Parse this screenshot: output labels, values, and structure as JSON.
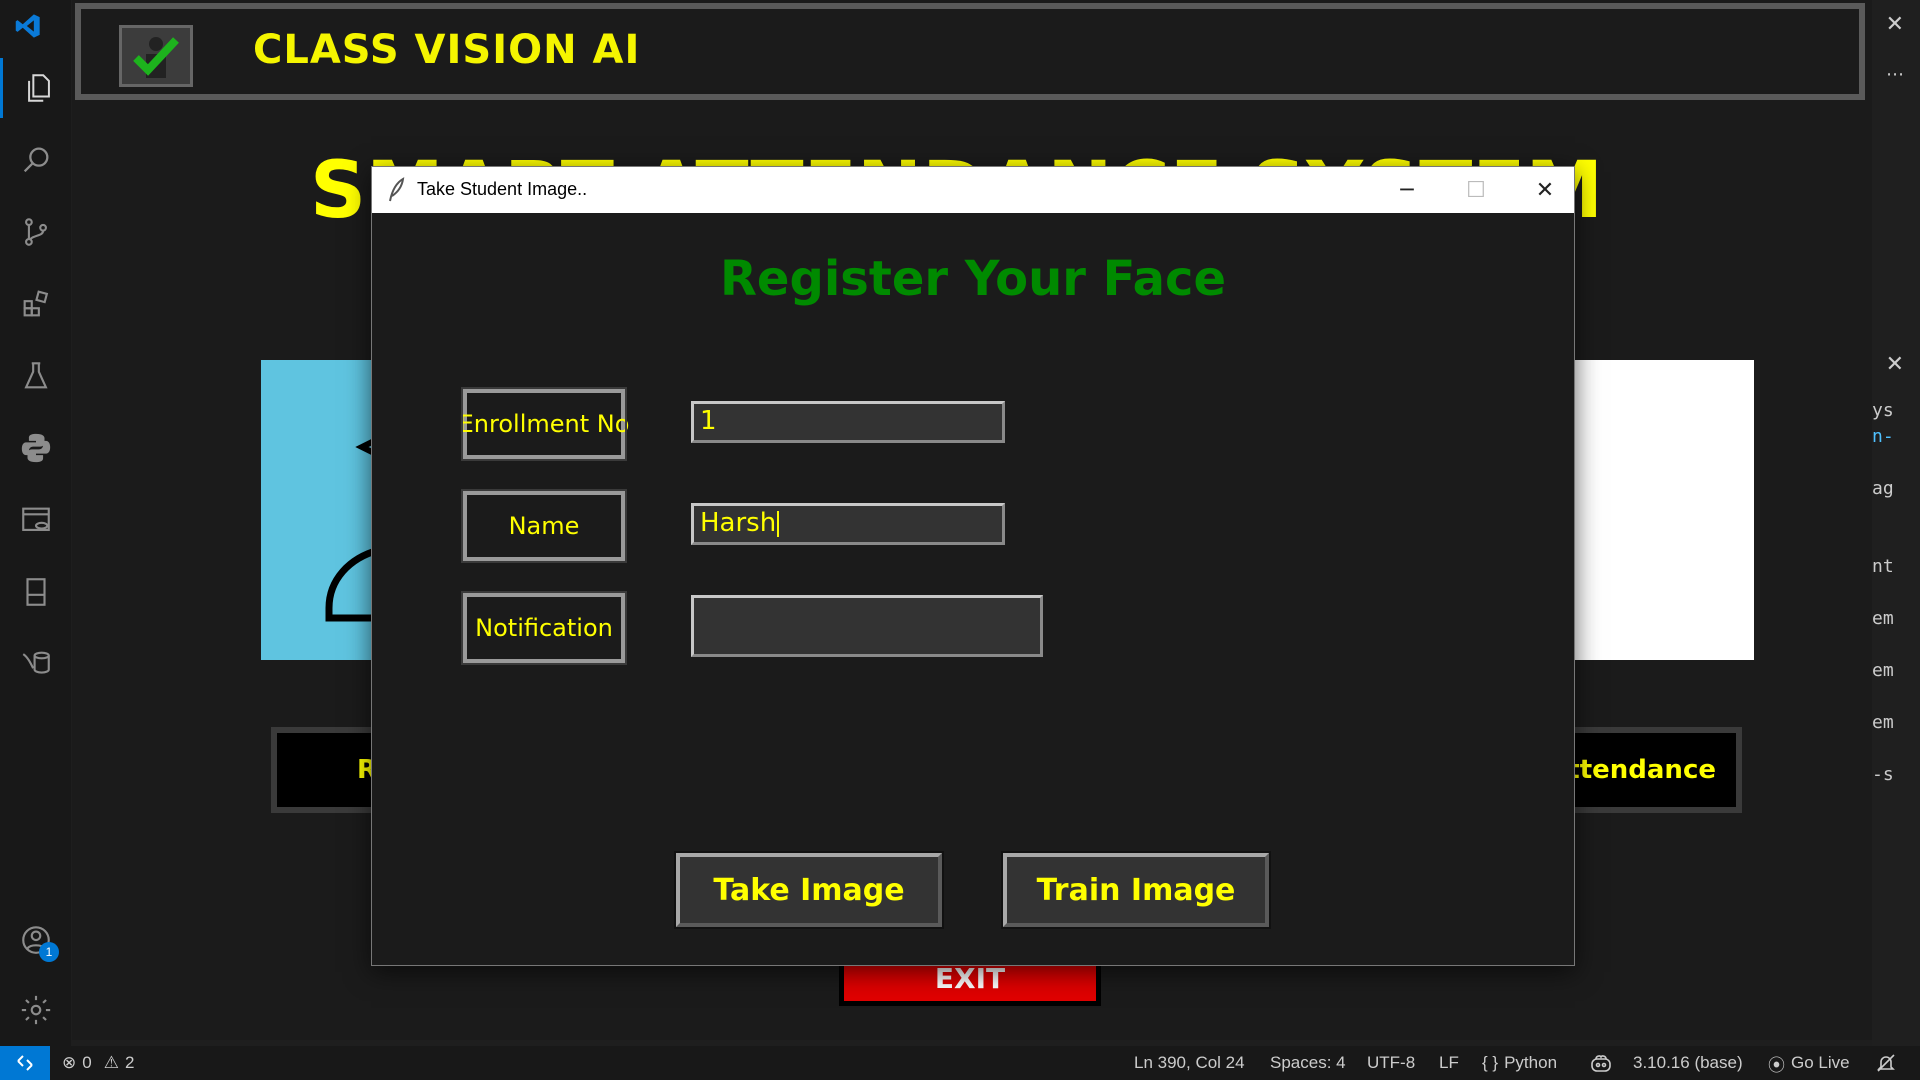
{
  "app": {
    "title": "CLASS VISION AI",
    "banner": "SMART ATTENDANCE SYSTEM",
    "left_button": "Register",
    "right_button": "Attendance",
    "exit_label": "EXIT"
  },
  "dialog": {
    "title": "Take Student Image..",
    "heading": "Register Your Face",
    "fields": {
      "enrollment_label": "Enrollment No",
      "enrollment_value": "1",
      "name_label": "Name",
      "name_value": "Harsh",
      "notification_label": "Notification",
      "notification_value": ""
    },
    "take_image_label": "Take Image",
    "train_image_label": "Train Image"
  },
  "activity_bar": {
    "items": [
      "explorer-icon",
      "search-icon",
      "source-control-icon",
      "extensions-icon",
      "testing-icon",
      "python-icon",
      "remote-explorer-icon",
      "notebook-icon",
      "database-icon"
    ],
    "accounts_badge": "1"
  },
  "side_text": [
    "ys",
    "n-",
    "ag",
    "nt",
    "em",
    "em",
    "em",
    "-s"
  ],
  "statusbar": {
    "errors": "0",
    "warnings": "2",
    "cursor": "Ln 390, Col 24",
    "spaces": "Spaces: 4",
    "encoding": "UTF-8",
    "eol": "LF",
    "language": "Python",
    "interpreter": "3.10.16 (base)",
    "live": "Go Live"
  },
  "colors": {
    "accent": "#0078d4",
    "title_yellow": "#ffff00",
    "heading_green": "#008a00",
    "exit_red": "#e00000"
  }
}
